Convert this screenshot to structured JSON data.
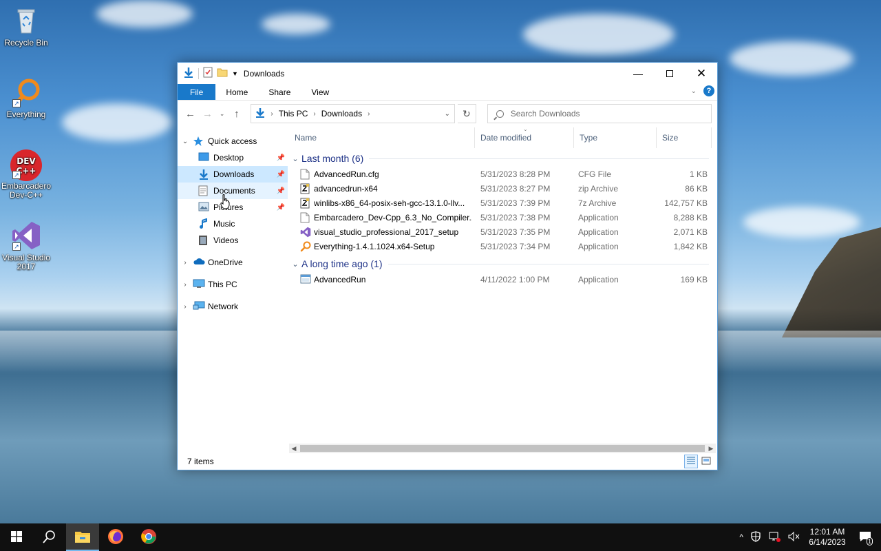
{
  "desktop": {
    "icons": [
      {
        "label": "Recycle Bin"
      },
      {
        "label": "Everything"
      },
      {
        "label": "Embarcadero Dev-C++",
        "badge": "DEV C++"
      },
      {
        "label": "Visual Studio 2017"
      }
    ]
  },
  "window": {
    "title": "Downloads",
    "ribbon_tabs": [
      "File",
      "Home",
      "Share",
      "View"
    ],
    "help": "?",
    "address": {
      "crumbs": [
        "This PC",
        "Downloads"
      ]
    },
    "search_placeholder": "Search Downloads",
    "nav": {
      "quick_access": "Quick access",
      "items": [
        "Desktop",
        "Downloads",
        "Documents",
        "Pictures",
        "Music",
        "Videos"
      ],
      "onedrive": "OneDrive",
      "this_pc": "This PC",
      "network": "Network"
    },
    "columns": [
      "Name",
      "Date modified",
      "Type",
      "Size"
    ],
    "groups": [
      {
        "label": "Last month (6)",
        "files": [
          {
            "name": "AdvancedRun.cfg",
            "date": "5/31/2023 8:28 PM",
            "type": "CFG File",
            "size": "1 KB",
            "icon": "file-icon"
          },
          {
            "name": "advancedrun-x64",
            "date": "5/31/2023 8:27 PM",
            "type": "zip Archive",
            "size": "86 KB",
            "icon": "archive-icon"
          },
          {
            "name": "winlibs-x86_64-posix-seh-gcc-13.1.0-llv...",
            "date": "5/31/2023 7:39 PM",
            "type": "7z Archive",
            "size": "142,757 KB",
            "icon": "archive-icon"
          },
          {
            "name": "Embarcadero_Dev-Cpp_6.3_No_Compiler...",
            "date": "5/31/2023 7:38 PM",
            "type": "Application",
            "size": "8,288 KB",
            "icon": "file-icon"
          },
          {
            "name": "visual_studio_professional_2017_setup",
            "date": "5/31/2023 7:35 PM",
            "type": "Application",
            "size": "2,071 KB",
            "icon": "visual-studio-icon"
          },
          {
            "name": "Everything-1.4.1.1024.x64-Setup",
            "date": "5/31/2023 7:34 PM",
            "type": "Application",
            "size": "1,842 KB",
            "icon": "everything-icon"
          }
        ]
      },
      {
        "label": "A long time ago (1)",
        "files": [
          {
            "name": "AdvancedRun",
            "date": "4/11/2022 1:00 PM",
            "type": "Application",
            "size": "169 KB",
            "icon": "app-window-icon"
          }
        ]
      }
    ],
    "status": "7 items"
  },
  "taskbar": {
    "time": "12:01 AM",
    "date": "6/14/2023",
    "notifications": "1"
  }
}
